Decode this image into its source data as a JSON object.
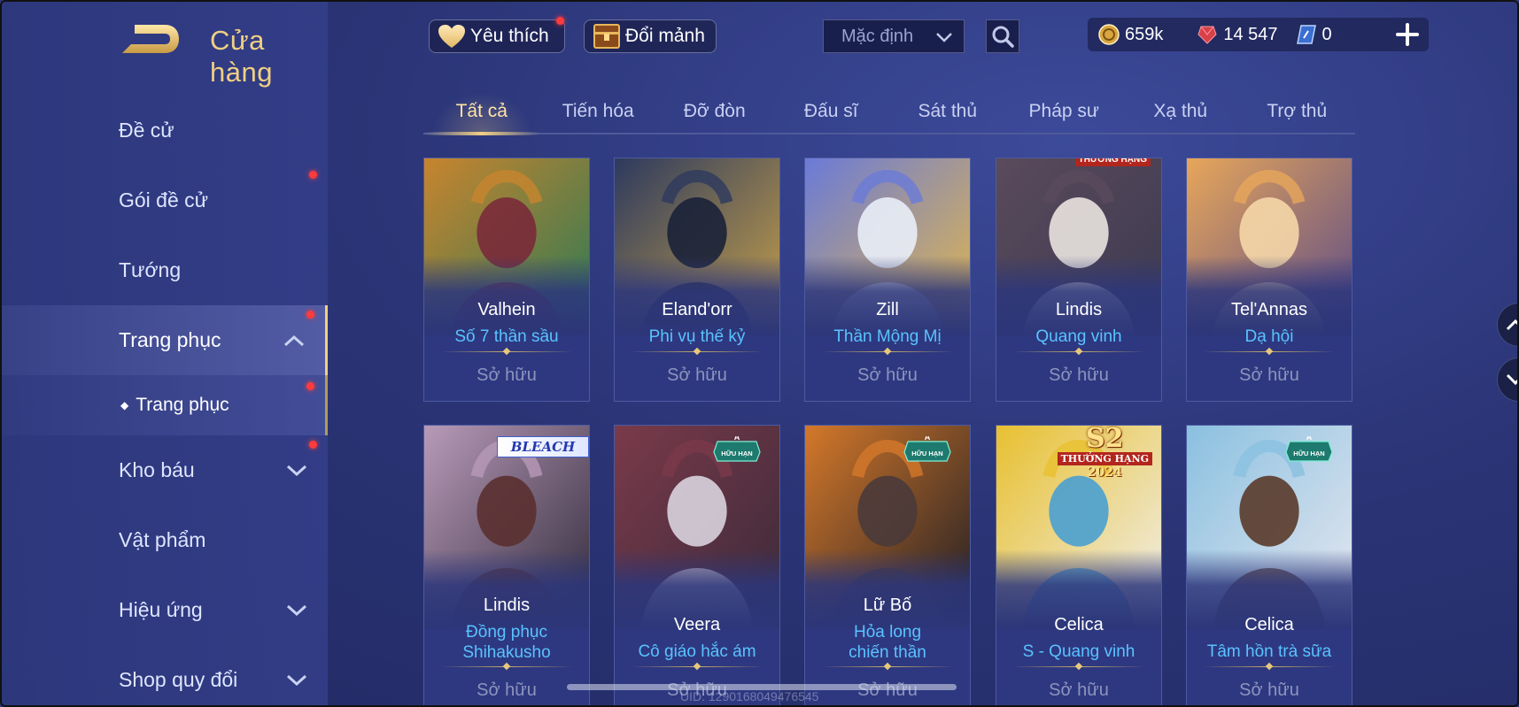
{
  "header": {
    "title": "Cửa hàng",
    "favorite_label": "Yêu thích",
    "exchange_label": "Đổi mảnh",
    "sort_value": "Mặc định"
  },
  "currency": {
    "gold": "659k",
    "gems": "14 547",
    "vouchers": "0"
  },
  "sidebar": {
    "items": [
      {
        "label": "Đề cử",
        "chevron": false,
        "dot": false
      },
      {
        "label": "Gói đề cử",
        "chevron": false,
        "dot": true
      },
      {
        "label": "Tướng",
        "chevron": false,
        "dot": false
      },
      {
        "label": "Trang phục",
        "chevron": "up",
        "dot": true,
        "active": true
      },
      {
        "label": "Trang phục",
        "sub": true,
        "dot": true
      },
      {
        "label": "Kho báu",
        "chevron": "down",
        "dot": true
      },
      {
        "label": "Vật phẩm",
        "chevron": false,
        "dot": false
      },
      {
        "label": "Hiệu ứng",
        "chevron": "down",
        "dot": false
      },
      {
        "label": "Shop quy đổi",
        "chevron": "down",
        "dot": false
      }
    ]
  },
  "tabs": [
    {
      "label": "Tất cả",
      "active": true
    },
    {
      "label": "Tiến hóa"
    },
    {
      "label": "Đỡ đòn"
    },
    {
      "label": "Đấu sĩ"
    },
    {
      "label": "Sát thủ"
    },
    {
      "label": "Pháp sư"
    },
    {
      "label": "Xạ thủ"
    },
    {
      "label": "Trợ thủ"
    }
  ],
  "cards": [
    {
      "hero": "Valhein",
      "skin": "Số 7 thần sầu",
      "status": "Sở hữu",
      "palette": [
        "#c8842e",
        "#7a2a3a",
        "#2a7a55"
      ]
    },
    {
      "hero": "Eland'orr",
      "skin": "Phi vụ thế kỷ",
      "status": "Sở hữu",
      "palette": [
        "#2d3a5e",
        "#1b2238",
        "#c9a24a"
      ]
    },
    {
      "hero": "Zill",
      "skin": "Thần Mộng Mị",
      "status": "Sở hữu",
      "palette": [
        "#6a7ad8",
        "#e9eef8",
        "#e4b84a"
      ]
    },
    {
      "hero": "Lindis",
      "skin": "Quang vinh",
      "status": "Sở hữu",
      "palette": [
        "#5a4a5c",
        "#e9e3e0",
        "#3c3a50"
      ],
      "badge": "partial",
      "badge_text": "THƯỞNG HẠNG"
    },
    {
      "hero": "Tel'Annas",
      "skin": "Dạ hội",
      "status": "Sở hữu",
      "palette": [
        "#e7a65a",
        "#f5d7a8",
        "#5a4a88"
      ]
    },
    {
      "hero": "Lindis",
      "skin": "Đồng phục Shihakusho",
      "status": "Sở hữu",
      "palette": [
        "#b89ab8",
        "#5a3030",
        "#302a3a"
      ],
      "badge": "bleach",
      "badge_text": "BLEACH"
    },
    {
      "hero": "Veera",
      "skin": "Cô giáo hắc ám",
      "status": "Sở hữu",
      "palette": [
        "#7a3a4a",
        "#d9d3de",
        "#3a2a3a"
      ],
      "badge": "limited",
      "badge_text": "HỮU HẠN"
    },
    {
      "hero": "Lữ Bố",
      "skin": "Hỏa long chiến thần",
      "status": "Sở hữu",
      "palette": [
        "#d4782a",
        "#4a3a3a",
        "#1c1c24"
      ],
      "badge": "limited",
      "badge_text": "HỮU HẠN"
    },
    {
      "hero": "Celica",
      "skin": "S - Quang vinh",
      "status": "Sở hữu",
      "palette": [
        "#e8c030",
        "#4aa0d0",
        "#f0f0f0"
      ],
      "badge": "rank",
      "badge_s2": "S2",
      "badge_rank": "THƯỞNG HẠNG",
      "badge_year": "2024"
    },
    {
      "hero": "Celica",
      "skin": "Tâm hồn trà sữa",
      "status": "Sở hữu",
      "palette": [
        "#8ac0e0",
        "#5a3a2a",
        "#e8e8f0"
      ],
      "badge": "limited",
      "badge_text": "HỮU HẠN"
    }
  ],
  "footer": {
    "uid": "UID: 1290168049476545"
  },
  "colors": {
    "accent_gold": "#f1cf82",
    "skin_blue": "#59c3ff",
    "owned_gray": "#8d94bd",
    "notify_red": "#ff3b3b"
  },
  "icons": {
    "back": "back-arrow-icon",
    "favorite": "heart-icon",
    "exchange": "treasure-chest-icon",
    "search": "search-icon",
    "gold": "gold-coin-icon",
    "gem": "ruby-gem-icon",
    "voucher": "voucher-icon",
    "plus": "plus-icon"
  }
}
